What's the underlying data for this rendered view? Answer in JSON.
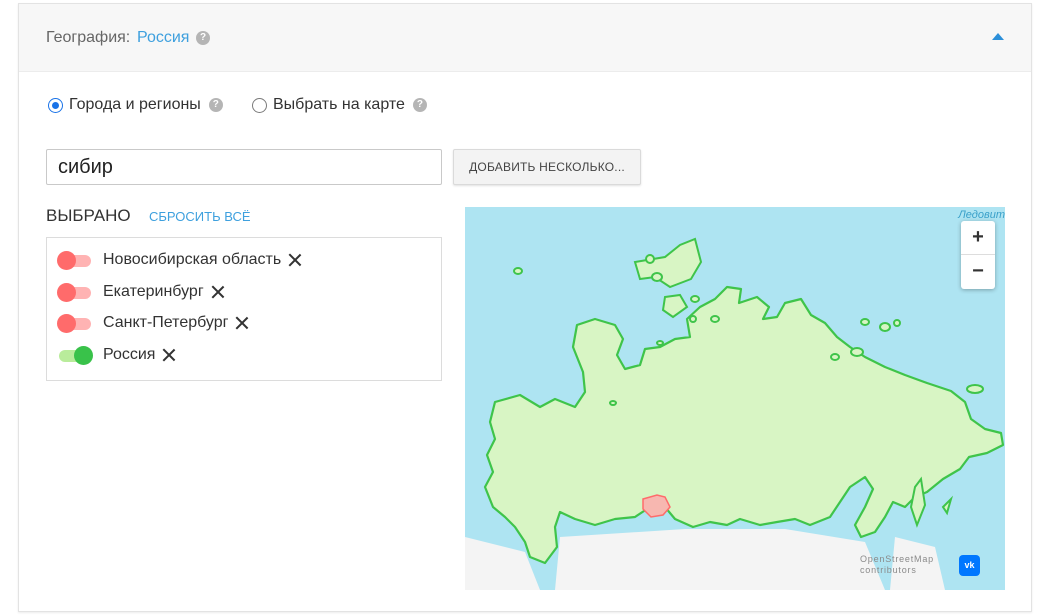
{
  "header": {
    "label": "География:",
    "value": "Россия",
    "help_icon": "?"
  },
  "mode": {
    "option_regions": "Города и регионы",
    "option_map": "Выбрать на карте",
    "selected": "option_regions"
  },
  "search": {
    "value": "сибир",
    "add_button": "ДОБАВИТЬ НЕСКОЛЬКО..."
  },
  "selected": {
    "title": "ВЫБРАНО",
    "reset_label": "СБРОСИТЬ ВСЁ",
    "items": [
      {
        "label": "Новосибирская область",
        "enabled": false
      },
      {
        "label": "Екатеринбург",
        "enabled": false
      },
      {
        "label": "Санкт-Петербург",
        "enabled": false
      },
      {
        "label": "Россия",
        "enabled": true
      }
    ]
  },
  "map": {
    "zoom_in": "+",
    "zoom_out": "−",
    "attribution_line1": "OpenStreetMap",
    "attribution_line2": "contributors",
    "vk_logo": "vk",
    "ice_label": "Ледовит"
  },
  "colors": {
    "accent": "#3ea0de",
    "toggle_off": "#ff6b6b",
    "toggle_on": "#39c24a",
    "map_water": "#aee4f2",
    "map_land": "#d8f5c4",
    "map_border": "#3fc44a"
  }
}
